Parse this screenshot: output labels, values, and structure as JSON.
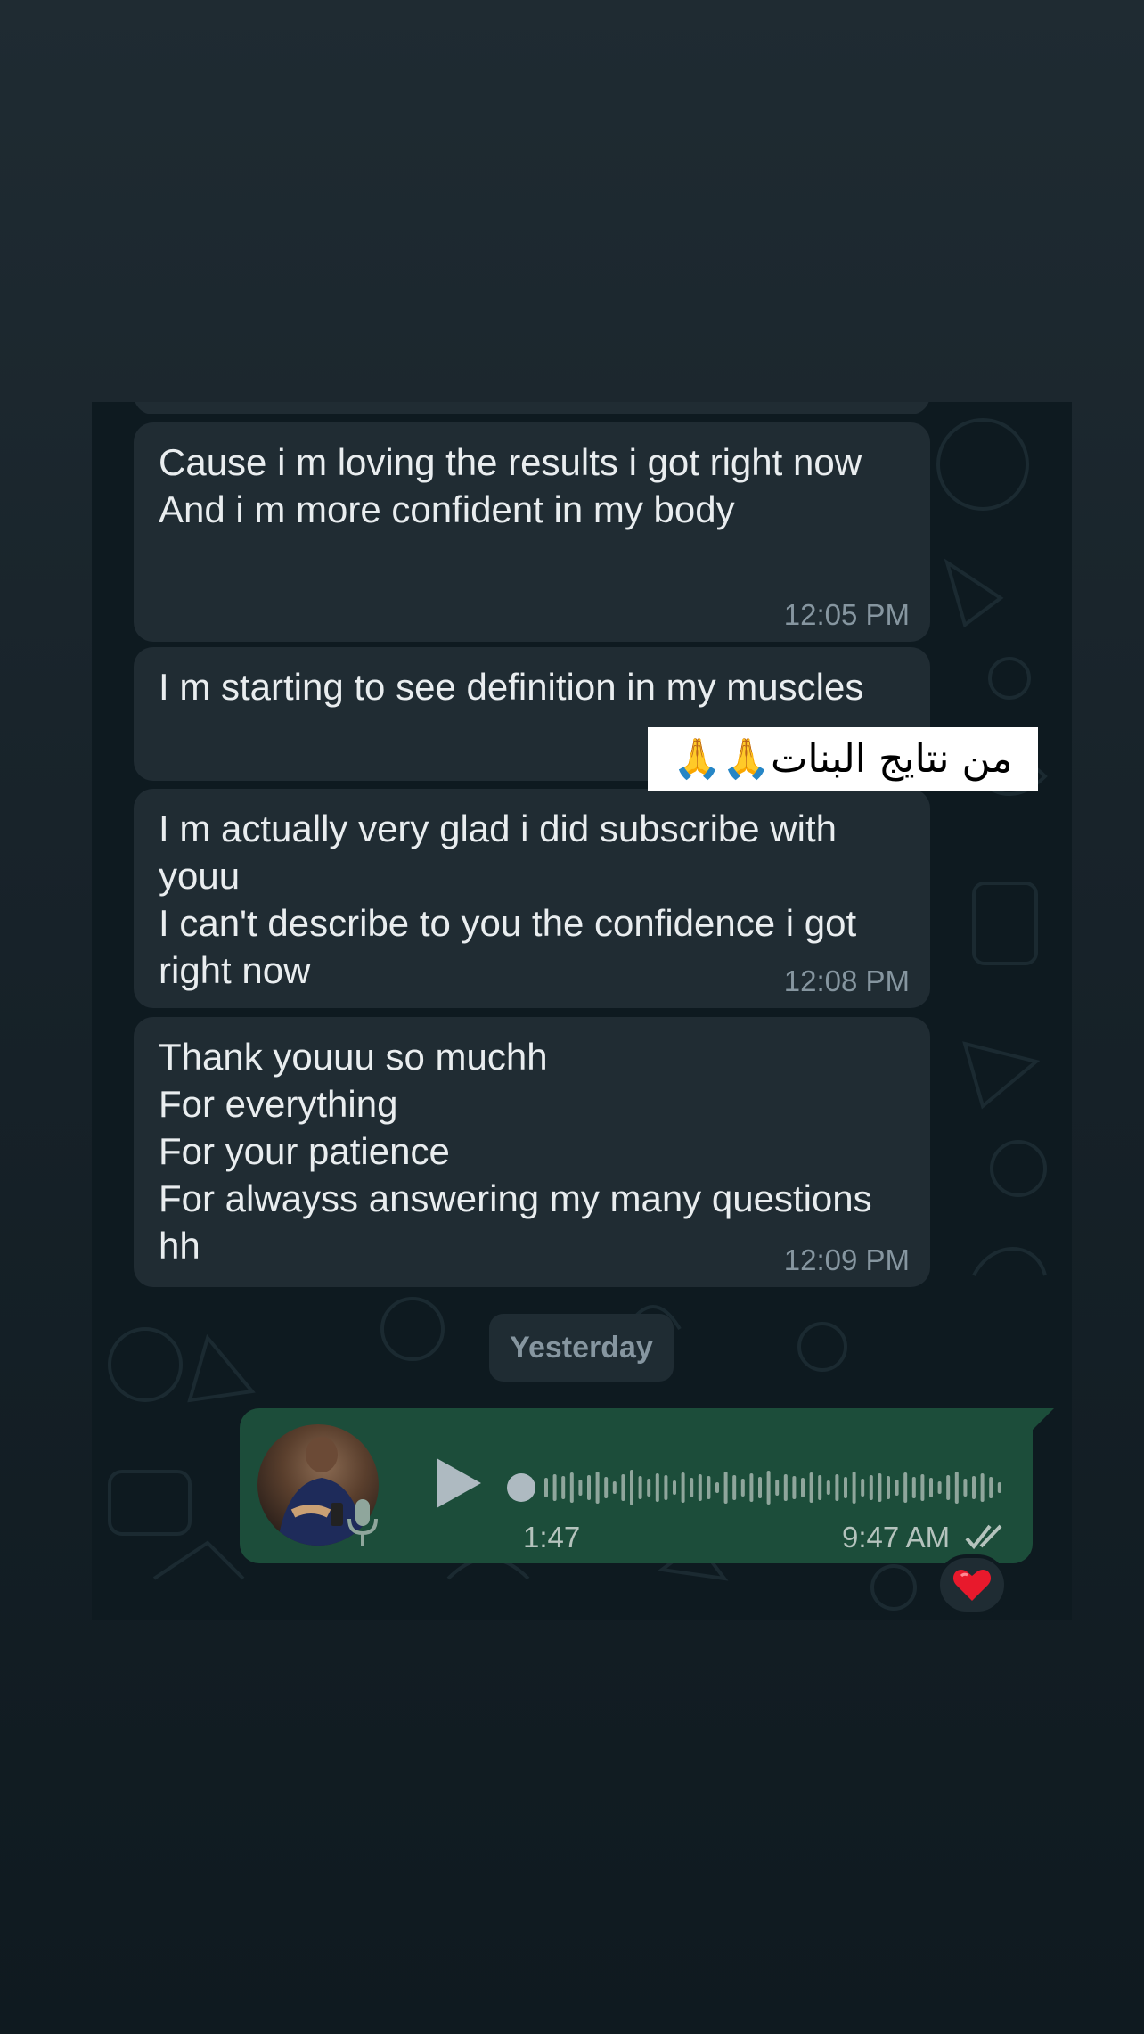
{
  "messages": [
    {
      "text": "Cause i m loving the results i got right now\nAnd i m more confident in my body",
      "time": "12:05 PM"
    },
    {
      "text": "I m starting to see definition in my muscles",
      "time": ""
    },
    {
      "text": "I m actually very glad i did subscribe with youu\nI can't describe to you the confidence i got right now",
      "time": "12:08 PM"
    },
    {
      "text": "Thank youuu so muchh\nFor everything\nFor your patience\nFor alwayss answering my many questions hh",
      "time": "12:09 PM"
    }
  ],
  "date_chip": "Yesterday",
  "voice_message": {
    "duration": "1:47",
    "time": "9:47 AM",
    "status_icon": "double-check-icon",
    "play_icon": "play-icon",
    "mic_icon": "microphone-icon",
    "progress": 0,
    "colors": {
      "bubble": "#1c4d3a",
      "wave": "#8fa69c",
      "dot": "#aebac1"
    }
  },
  "reaction": {
    "emoji": "❤️"
  },
  "overlay_caption": "من نتايج البنات🙏🙏",
  "colors": {
    "incoming_bubble": "#202c33",
    "chat_background": "#0e1a20",
    "text": "#e9edef",
    "meta_text": "#8696a0"
  }
}
